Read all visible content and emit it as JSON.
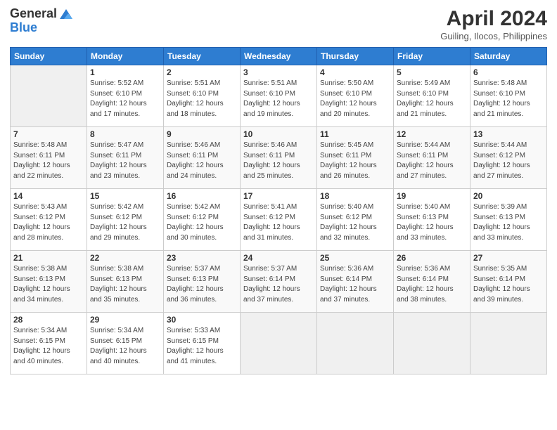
{
  "header": {
    "logo_line1": "General",
    "logo_line2": "Blue",
    "month_year": "April 2024",
    "location": "Guiling, Ilocos, Philippines"
  },
  "days_of_week": [
    "Sunday",
    "Monday",
    "Tuesday",
    "Wednesday",
    "Thursday",
    "Friday",
    "Saturday"
  ],
  "weeks": [
    [
      {
        "day": "",
        "empty": true
      },
      {
        "day": "1",
        "sunrise": "Sunrise: 5:52 AM",
        "sunset": "Sunset: 6:10 PM",
        "daylight": "Daylight: 12 hours and 17 minutes."
      },
      {
        "day": "2",
        "sunrise": "Sunrise: 5:51 AM",
        "sunset": "Sunset: 6:10 PM",
        "daylight": "Daylight: 12 hours and 18 minutes."
      },
      {
        "day": "3",
        "sunrise": "Sunrise: 5:51 AM",
        "sunset": "Sunset: 6:10 PM",
        "daylight": "Daylight: 12 hours and 19 minutes."
      },
      {
        "day": "4",
        "sunrise": "Sunrise: 5:50 AM",
        "sunset": "Sunset: 6:10 PM",
        "daylight": "Daylight: 12 hours and 20 minutes."
      },
      {
        "day": "5",
        "sunrise": "Sunrise: 5:49 AM",
        "sunset": "Sunset: 6:10 PM",
        "daylight": "Daylight: 12 hours and 21 minutes."
      },
      {
        "day": "6",
        "sunrise": "Sunrise: 5:48 AM",
        "sunset": "Sunset: 6:10 PM",
        "daylight": "Daylight: 12 hours and 21 minutes."
      }
    ],
    [
      {
        "day": "7",
        "sunrise": "Sunrise: 5:48 AM",
        "sunset": "Sunset: 6:11 PM",
        "daylight": "Daylight: 12 hours and 22 minutes."
      },
      {
        "day": "8",
        "sunrise": "Sunrise: 5:47 AM",
        "sunset": "Sunset: 6:11 PM",
        "daylight": "Daylight: 12 hours and 23 minutes."
      },
      {
        "day": "9",
        "sunrise": "Sunrise: 5:46 AM",
        "sunset": "Sunset: 6:11 PM",
        "daylight": "Daylight: 12 hours and 24 minutes."
      },
      {
        "day": "10",
        "sunrise": "Sunrise: 5:46 AM",
        "sunset": "Sunset: 6:11 PM",
        "daylight": "Daylight: 12 hours and 25 minutes."
      },
      {
        "day": "11",
        "sunrise": "Sunrise: 5:45 AM",
        "sunset": "Sunset: 6:11 PM",
        "daylight": "Daylight: 12 hours and 26 minutes."
      },
      {
        "day": "12",
        "sunrise": "Sunrise: 5:44 AM",
        "sunset": "Sunset: 6:11 PM",
        "daylight": "Daylight: 12 hours and 27 minutes."
      },
      {
        "day": "13",
        "sunrise": "Sunrise: 5:44 AM",
        "sunset": "Sunset: 6:12 PM",
        "daylight": "Daylight: 12 hours and 27 minutes."
      }
    ],
    [
      {
        "day": "14",
        "sunrise": "Sunrise: 5:43 AM",
        "sunset": "Sunset: 6:12 PM",
        "daylight": "Daylight: 12 hours and 28 minutes."
      },
      {
        "day": "15",
        "sunrise": "Sunrise: 5:42 AM",
        "sunset": "Sunset: 6:12 PM",
        "daylight": "Daylight: 12 hours and 29 minutes."
      },
      {
        "day": "16",
        "sunrise": "Sunrise: 5:42 AM",
        "sunset": "Sunset: 6:12 PM",
        "daylight": "Daylight: 12 hours and 30 minutes."
      },
      {
        "day": "17",
        "sunrise": "Sunrise: 5:41 AM",
        "sunset": "Sunset: 6:12 PM",
        "daylight": "Daylight: 12 hours and 31 minutes."
      },
      {
        "day": "18",
        "sunrise": "Sunrise: 5:40 AM",
        "sunset": "Sunset: 6:12 PM",
        "daylight": "Daylight: 12 hours and 32 minutes."
      },
      {
        "day": "19",
        "sunrise": "Sunrise: 5:40 AM",
        "sunset": "Sunset: 6:13 PM",
        "daylight": "Daylight: 12 hours and 33 minutes."
      },
      {
        "day": "20",
        "sunrise": "Sunrise: 5:39 AM",
        "sunset": "Sunset: 6:13 PM",
        "daylight": "Daylight: 12 hours and 33 minutes."
      }
    ],
    [
      {
        "day": "21",
        "sunrise": "Sunrise: 5:38 AM",
        "sunset": "Sunset: 6:13 PM",
        "daylight": "Daylight: 12 hours and 34 minutes."
      },
      {
        "day": "22",
        "sunrise": "Sunrise: 5:38 AM",
        "sunset": "Sunset: 6:13 PM",
        "daylight": "Daylight: 12 hours and 35 minutes."
      },
      {
        "day": "23",
        "sunrise": "Sunrise: 5:37 AM",
        "sunset": "Sunset: 6:13 PM",
        "daylight": "Daylight: 12 hours and 36 minutes."
      },
      {
        "day": "24",
        "sunrise": "Sunrise: 5:37 AM",
        "sunset": "Sunset: 6:14 PM",
        "daylight": "Daylight: 12 hours and 37 minutes."
      },
      {
        "day": "25",
        "sunrise": "Sunrise: 5:36 AM",
        "sunset": "Sunset: 6:14 PM",
        "daylight": "Daylight: 12 hours and 37 minutes."
      },
      {
        "day": "26",
        "sunrise": "Sunrise: 5:36 AM",
        "sunset": "Sunset: 6:14 PM",
        "daylight": "Daylight: 12 hours and 38 minutes."
      },
      {
        "day": "27",
        "sunrise": "Sunrise: 5:35 AM",
        "sunset": "Sunset: 6:14 PM",
        "daylight": "Daylight: 12 hours and 39 minutes."
      }
    ],
    [
      {
        "day": "28",
        "sunrise": "Sunrise: 5:34 AM",
        "sunset": "Sunset: 6:15 PM",
        "daylight": "Daylight: 12 hours and 40 minutes."
      },
      {
        "day": "29",
        "sunrise": "Sunrise: 5:34 AM",
        "sunset": "Sunset: 6:15 PM",
        "daylight": "Daylight: 12 hours and 40 minutes."
      },
      {
        "day": "30",
        "sunrise": "Sunrise: 5:33 AM",
        "sunset": "Sunset: 6:15 PM",
        "daylight": "Daylight: 12 hours and 41 minutes."
      },
      {
        "day": "",
        "empty": true
      },
      {
        "day": "",
        "empty": true
      },
      {
        "day": "",
        "empty": true
      },
      {
        "day": "",
        "empty": true
      }
    ]
  ]
}
